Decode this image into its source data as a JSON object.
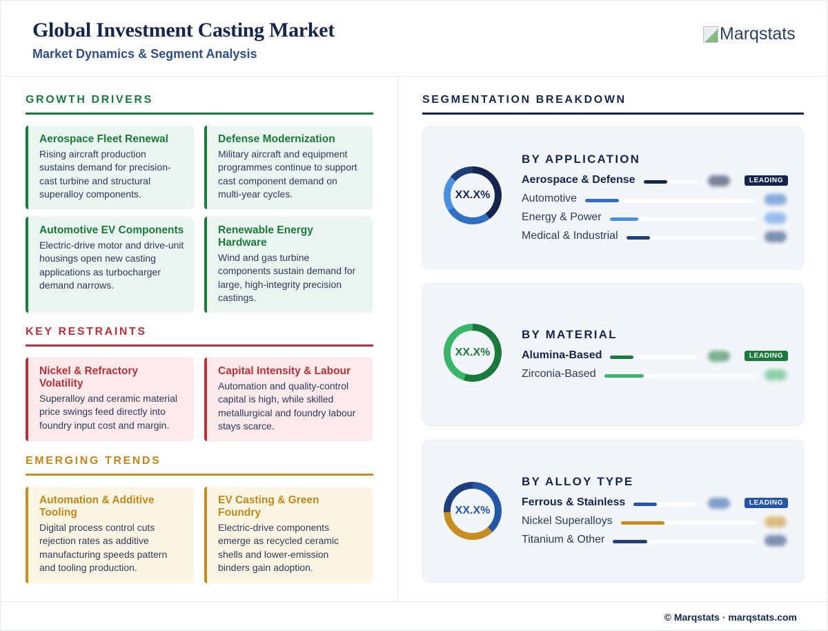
{
  "header": {
    "title": "Global Investment Casting Market",
    "subtitle": "Market Dynamics & Segment Analysis",
    "logo_text": "Marqstats"
  },
  "growth_drivers": {
    "heading": "GROWTH DRIVERS",
    "color": "#1a7a3c",
    "cards": [
      {
        "title": "Aerospace Fleet Renewal",
        "body": "Rising aircraft production sustains demand for precision-cast turbine and structural superalloy components."
      },
      {
        "title": "Defense Modernization",
        "body": "Military aircraft and equipment programmes continue to support cast component demand on multi-year cycles."
      },
      {
        "title": "Automotive EV Components",
        "body": "Electric-drive motor and drive-unit housings open new casting applications as turbocharger demand narrows."
      },
      {
        "title": "Renewable Energy Hardware",
        "body": "Wind and gas turbine components sustain demand for large, high-integrity precision castings."
      }
    ]
  },
  "key_restraints": {
    "heading": "KEY RESTRAINTS",
    "color": "#b7313a",
    "cards": [
      {
        "title": "Nickel & Refractory Volatility",
        "body": "Superalloy and ceramic material price swings feed directly into foundry input cost and margin."
      },
      {
        "title": "Capital Intensity & Labour",
        "body": "Automation and quality-control capital is high, while skilled metallurgical and foundry labour stays scarce."
      }
    ]
  },
  "emerging_trends": {
    "heading": "EMERGING TRENDS",
    "color": "#c78d1e",
    "cards": [
      {
        "title": "Automation & Additive Tooling",
        "body": "Digital process control cuts rejection rates as additive manufacturing speeds pattern and tooling production."
      },
      {
        "title": "EV Casting & Green Foundry",
        "body": "Electric-drive components emerge as recycled ceramic shells and lower-emission binders gain adoption."
      }
    ]
  },
  "segmentation": {
    "heading": "SEGMENTATION BREAKDOWN",
    "panels": [
      {
        "title": "BY APPLICATION",
        "donut_label": "XX.X%",
        "donut_label_color": "#15254d",
        "badge": "LEADING",
        "badge_color": "#15254d",
        "segments": [
          {
            "label": "Aerospace & Defense",
            "share": 0.4,
            "color": "#15254d",
            "lead": true
          },
          {
            "label": "Automotive",
            "share": 0.26,
            "color": "#2f6fc4",
            "lead": false
          },
          {
            "label": "Energy & Power",
            "share": 0.2,
            "color": "#4a90e2",
            "lead": false
          },
          {
            "label": "Medical & Industrial",
            "share": 0.14,
            "color": "#1e3f7a",
            "lead": false
          }
        ]
      },
      {
        "title": "BY MATERIAL",
        "donut_label": "XX.X%",
        "donut_label_color": "#1a7a3c",
        "badge": "LEADING",
        "badge_color": "#1a7a3c",
        "segments": [
          {
            "label": "Alumina-Based",
            "share": 0.55,
            "color": "#1a7a3c",
            "lead": true
          },
          {
            "label": "Zirconia-Based",
            "share": 0.45,
            "color": "#3bb56a",
            "lead": false
          }
        ]
      },
      {
        "title": "BY ALLOY TYPE",
        "donut_label": "XX.X%",
        "donut_label_color": "#2456a8",
        "badge": "LEADING",
        "badge_color": "#2456a8",
        "segments": [
          {
            "label": "Ferrous & Stainless",
            "share": 0.38,
            "color": "#2456a8",
            "lead": true
          },
          {
            "label": "Nickel Superalloys",
            "share": 0.36,
            "color": "#c78d1e",
            "lead": false
          },
          {
            "label": "Titanium & Other",
            "share": 0.26,
            "color": "#1e3f7a",
            "lead": false
          }
        ]
      }
    ]
  },
  "footer": {
    "text": "© Marqstats · marqstats.com"
  }
}
